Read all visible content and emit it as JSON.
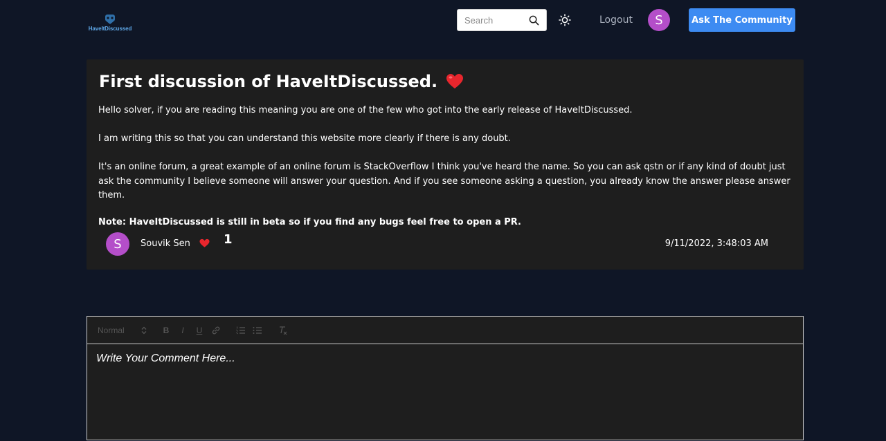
{
  "header": {
    "logo_text": "HaveItDiscussed",
    "search_placeholder": "Search",
    "logout_label": "Logout",
    "avatar_initial": "S",
    "ask_button_label": "Ask The Community"
  },
  "post": {
    "title": "First discussion of HaveItDiscussed.",
    "paragraphs": [
      "Hello solver, if you are reading this meaning you are one of the few who got into the early release of HaveItDiscussed.",
      "I am writing this so that you can understand this website more clearly if there is any doubt.",
      "It's an online forum, a great example of an online forum is StackOverflow I think you've heard the name. So you can ask qstn or if any kind of doubt just ask the community I believe someone will answer your question. And if you see someone asking a question, you already know the answer please answer them."
    ],
    "note": "Note: HaveItDiscussed is still in beta so if you find any bugs feel free to open a PR.",
    "author": {
      "initial": "S",
      "name": "Souvik Sen"
    },
    "likes": "1",
    "timestamp": "9/11/2022, 3:48:03 AM"
  },
  "editor": {
    "format_select": "Normal",
    "toolbar": {
      "bold": "B",
      "italic": "I",
      "underline": "U"
    },
    "placeholder": "Write Your Comment Here..."
  },
  "colors": {
    "background": "#0f1626",
    "card": "#1e1e1e",
    "accent": "#3d8bf2",
    "avatar": "#b44ec9",
    "heart": "#e8262d"
  }
}
